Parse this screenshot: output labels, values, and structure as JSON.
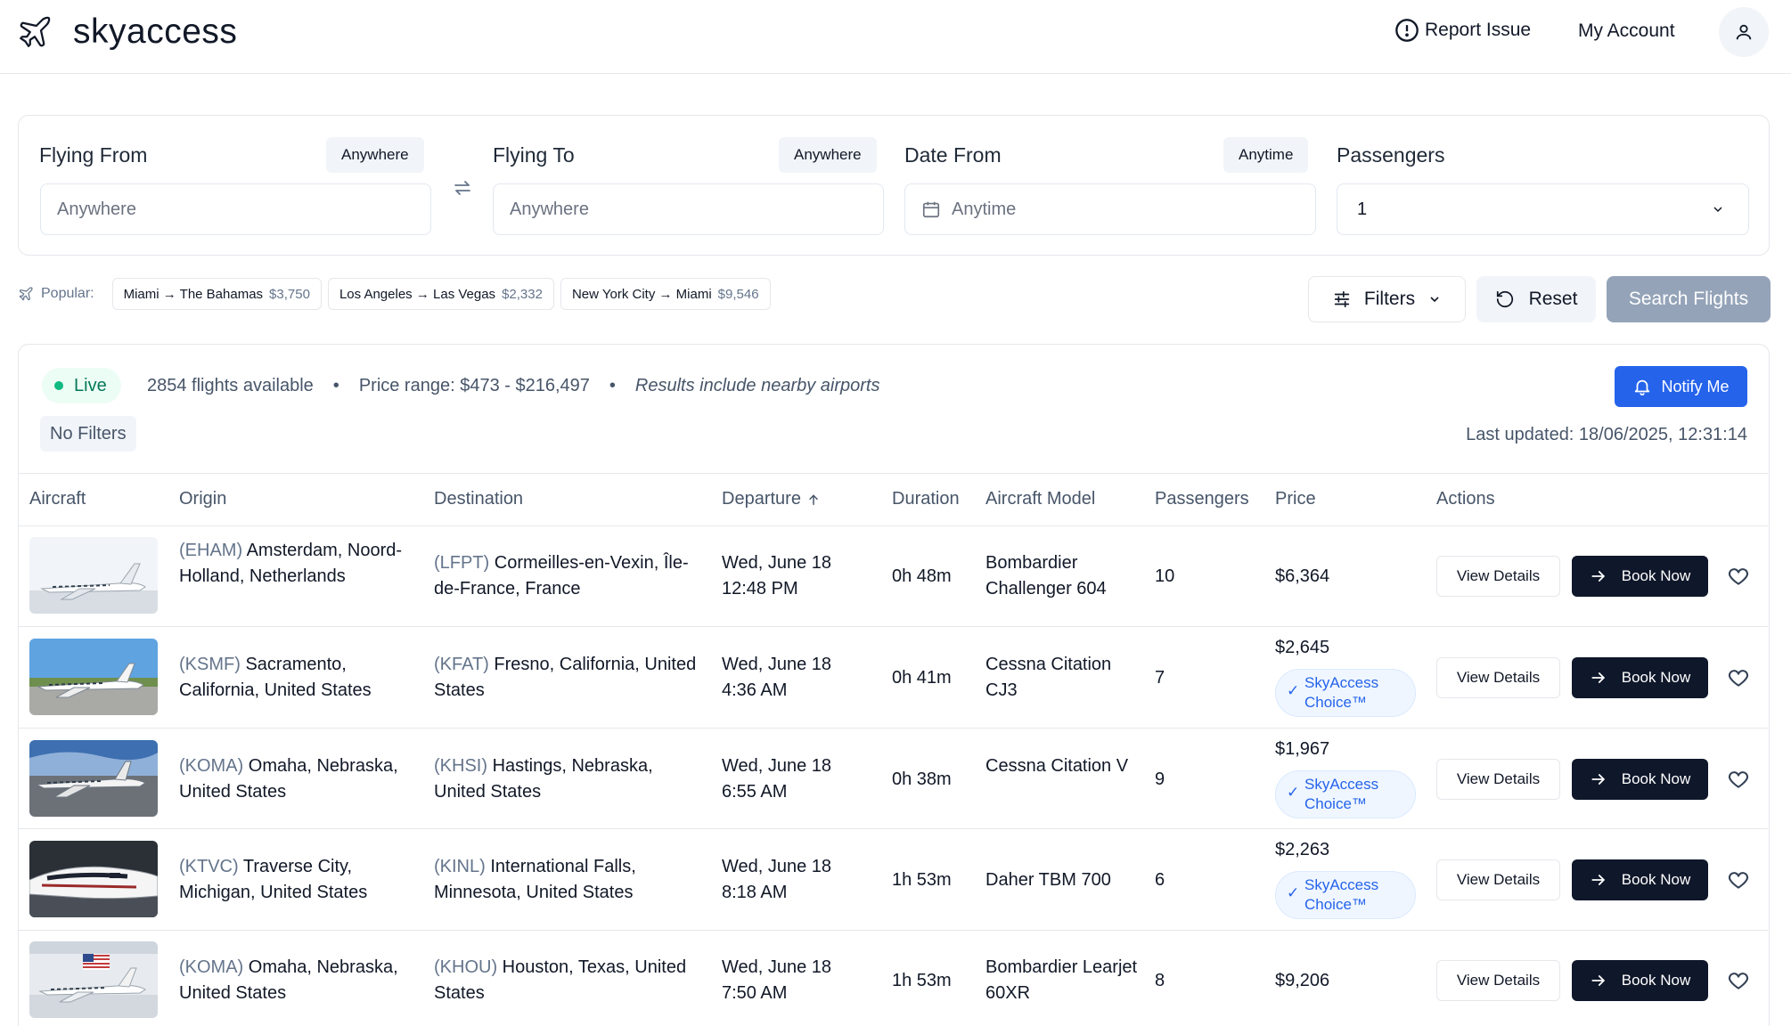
{
  "header": {
    "logo_text": "skyaccess",
    "report_issue": "Report Issue",
    "my_account": "My Account"
  },
  "search": {
    "from": {
      "label": "Flying From",
      "chip": "Anywhere",
      "placeholder": "Anywhere"
    },
    "to": {
      "label": "Flying To",
      "chip": "Anywhere",
      "placeholder": "Anywhere"
    },
    "date": {
      "label": "Date From",
      "chip": "Anytime",
      "placeholder": "Anytime"
    },
    "passengers": {
      "label": "Passengers",
      "value": "1"
    }
  },
  "popular": {
    "label": "Popular:",
    "routes": [
      {
        "route": "Miami → The Bahamas",
        "price": "$3,750"
      },
      {
        "route": "Los Angeles → Las Vegas",
        "price": "$2,332"
      },
      {
        "route": "New York City → Miami",
        "price": "$9,546"
      }
    ]
  },
  "actions": {
    "filters": "Filters",
    "reset": "Reset",
    "search": "Search Flights"
  },
  "results": {
    "live": "Live",
    "count": "2854 flights available",
    "price_range": "Price range: $473 - $216,497",
    "nearby": "Results include nearby airports",
    "notify": "Notify Me",
    "no_filters": "No Filters",
    "last_updated": "Last updated: 18/06/2025, 12:31:14"
  },
  "table": {
    "columns": {
      "aircraft": "Aircraft",
      "origin": "Origin",
      "destination": "Destination",
      "departure": "Departure",
      "duration": "Duration",
      "model": "Aircraft Model",
      "passengers": "Passengers",
      "price": "Price",
      "actions": "Actions"
    },
    "view_label": "View Details",
    "book_label": "Book Now",
    "choice_label": "SkyAccess Choice™",
    "rows": [
      {
        "origin_code": "(EHAM)",
        "origin": "Amsterdam, Noord-Holland, Netherlands",
        "dest_code": "(LFPT)",
        "dest": "Cormeilles-en-Vexin, Île-de-France, France",
        "dep_date": "Wed, June 18",
        "dep_time": "12:48 PM",
        "duration": "0h 48m",
        "model": "Bombardier Challenger 604",
        "passengers": "10",
        "price": "$6,364",
        "choice": false
      },
      {
        "origin_code": "(KSMF)",
        "origin": "Sacramento, California, United States",
        "dest_code": "(KFAT)",
        "dest": "Fresno, California, United States",
        "dep_date": "Wed, June 18",
        "dep_time": "4:36 AM",
        "duration": "0h 41m",
        "model": "Cessna Citation CJ3",
        "passengers": "7",
        "price": "$2,645",
        "choice": true
      },
      {
        "origin_code": "(KOMA)",
        "origin": "Omaha, Nebraska, United States",
        "dest_code": "(KHSI)",
        "dest": "Hastings, Nebraska, United States",
        "dep_date": "Wed, June 18",
        "dep_time": "6:55 AM",
        "duration": "0h 38m",
        "model": "Cessna Citation V",
        "passengers": "9",
        "price": "$1,967",
        "choice": true
      },
      {
        "origin_code": "(KTVC)",
        "origin": "Traverse City, Michigan, United States",
        "dest_code": "(KINL)",
        "dest": "International Falls, Minnesota, United States",
        "dep_date": "Wed, June 18",
        "dep_time": "8:18 AM",
        "duration": "1h 53m",
        "model": "Daher TBM 700",
        "passengers": "6",
        "price": "$2,263",
        "choice": true
      },
      {
        "origin_code": "(KOMA)",
        "origin": "Omaha, Nebraska, United States",
        "dest_code": "(KHOU)",
        "dest": "Houston, Texas, United States",
        "dep_date": "Wed, June 18",
        "dep_time": "7:50 AM",
        "duration": "1h 53m",
        "model": "Bombardier Learjet 60XR",
        "passengers": "8",
        "price": "$9,206",
        "choice": false
      }
    ]
  },
  "colors": {
    "primary": "#0f172a",
    "accent": "#2563eb",
    "live": "#10b981",
    "muted": "#64748b",
    "border": "#e5e7eb"
  },
  "icons": {
    "logo": "plane-icon",
    "report": "alert-circle-icon",
    "account": "user-icon",
    "swap": "swap-arrows-icon",
    "calendar": "calendar-icon",
    "filters": "sliders-icon",
    "reset": "rotate-icon",
    "notify": "bell-icon",
    "book": "arrow-right-icon",
    "favorite": "heart-icon"
  }
}
